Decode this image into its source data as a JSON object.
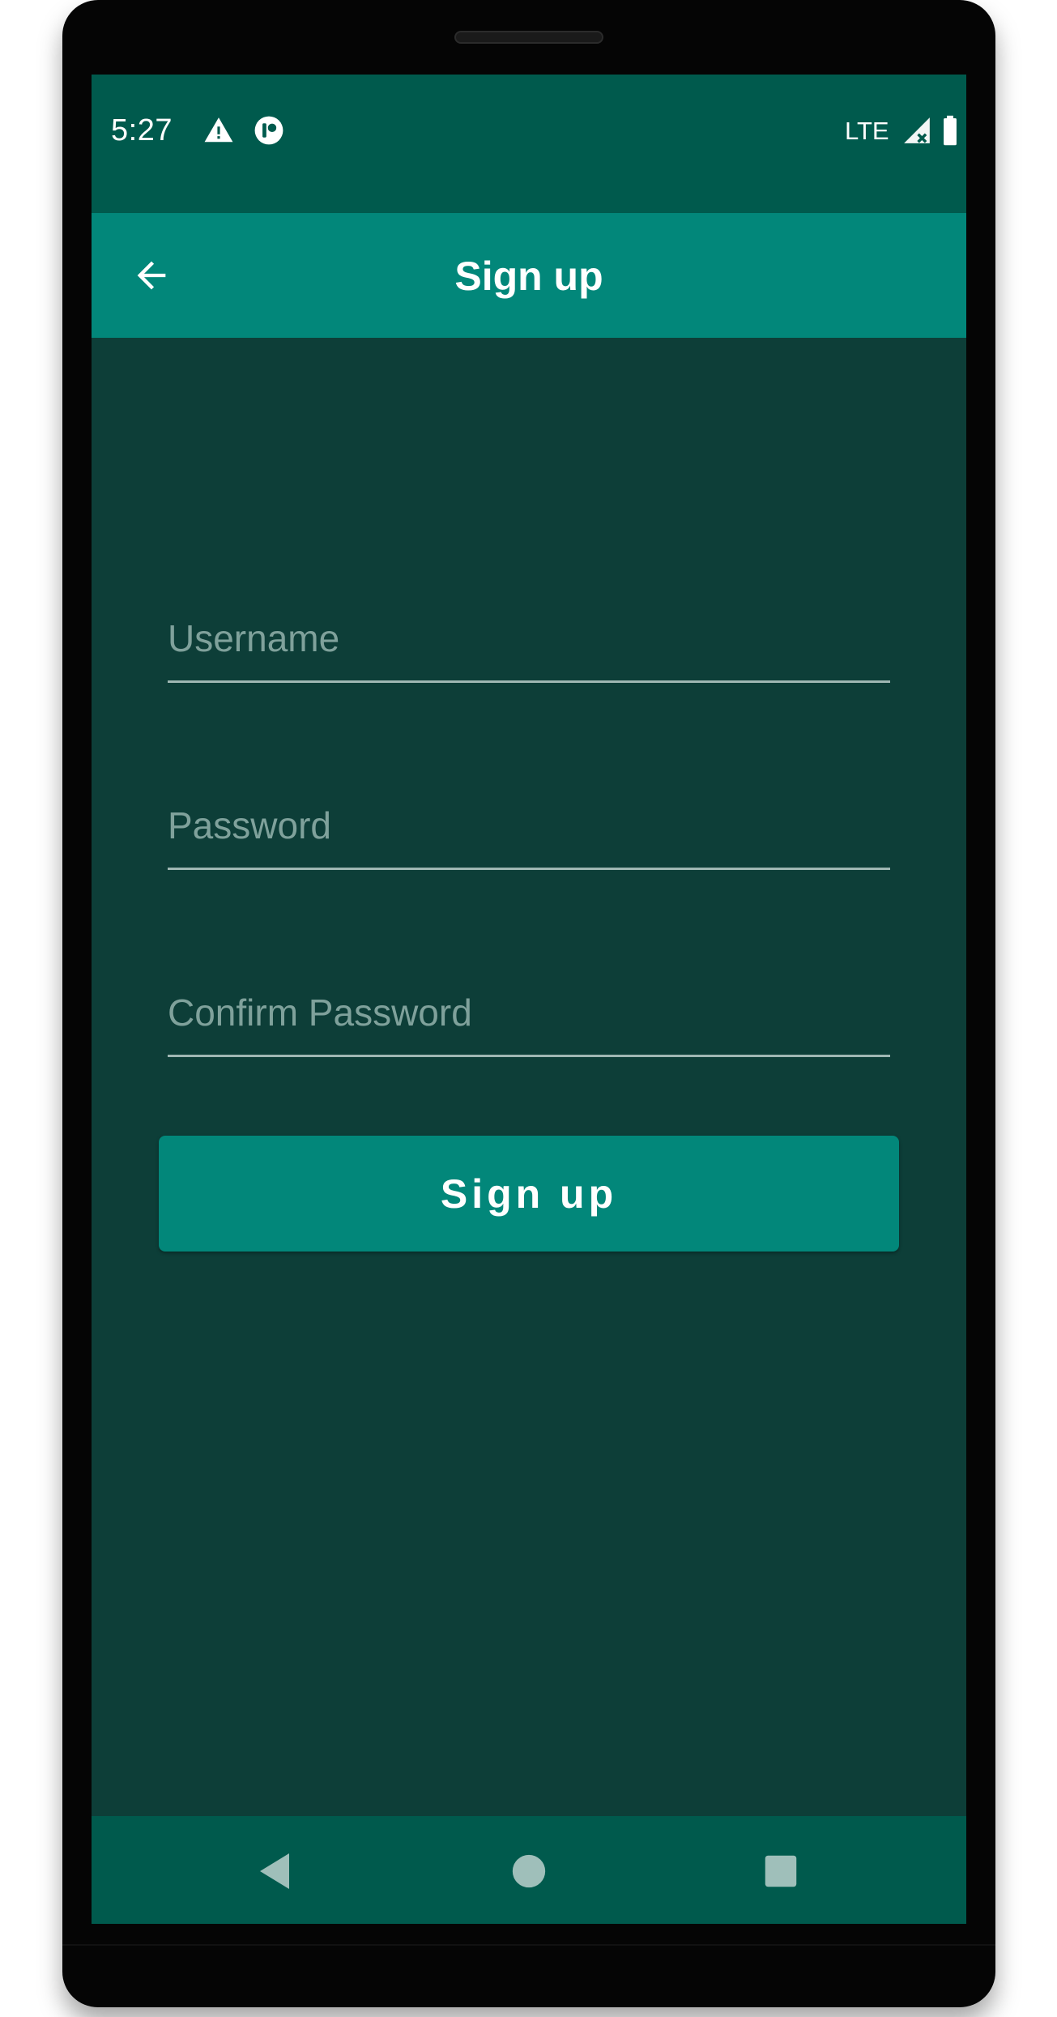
{
  "status_bar": {
    "time": "5:27",
    "network": "LTE",
    "icons": [
      "warning-icon",
      "notification-app-icon",
      "signal-icon",
      "battery-icon"
    ]
  },
  "app_bar": {
    "title": "Sign up",
    "back_icon": "arrow-left-icon"
  },
  "form": {
    "username": {
      "value": "",
      "placeholder": "Username"
    },
    "password": {
      "value": "",
      "placeholder": "Password"
    },
    "confirm_password": {
      "value": "",
      "placeholder": "Confirm Password"
    },
    "submit_label": "Sign up"
  },
  "nav_bar": {
    "icons": [
      "back-triangle-icon",
      "home-circle-icon",
      "recents-square-icon"
    ]
  },
  "colors": {
    "status_bar": "#005a4d",
    "app_bar": "#02877a",
    "background": "#0d3e38",
    "accent": "#02877a",
    "placeholder": "#7fa19b"
  }
}
